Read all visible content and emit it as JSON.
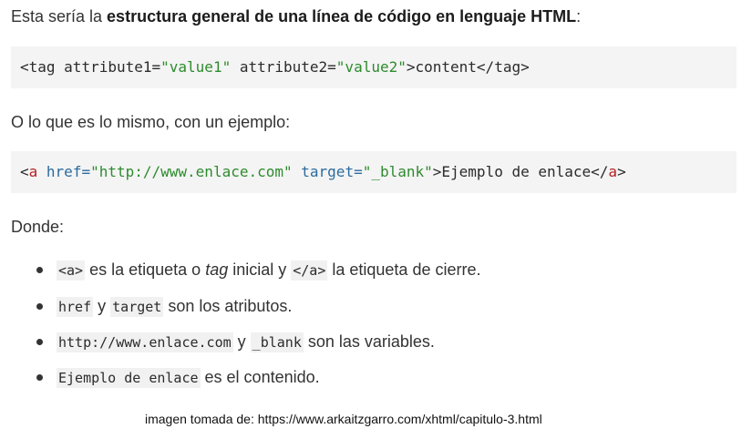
{
  "intro": {
    "prefix": "Esta sería la ",
    "bold": "estructura general de una línea de código en lenguaje HTML",
    "suffix": ":"
  },
  "code1": {
    "open": "<tag ",
    "attr1": "attribute1=",
    "val1": "\"value1\"",
    "attr2": " attribute2=",
    "val2": "\"value2\"",
    "close": ">content</tag>"
  },
  "example_intro": "O lo que es lo mismo, con un ejemplo:",
  "code2": {
    "lt": "<",
    "tag": "a",
    "href_attr": " href=",
    "href_val": "\"http://www.enlace.com\"",
    "target_attr": " target=",
    "target_val": "\"_blank\"",
    "mid": ">Ejemplo de enlace</",
    "end_tag": "a",
    "gt": ">"
  },
  "donde": "Donde:",
  "bullets": [
    {
      "code1": "<a>",
      "t1": " es la etiqueta o ",
      "em": "tag",
      "t2": " inicial y ",
      "code2": "</a>",
      "t3": " la etiqueta de cierre."
    },
    {
      "code1": "href",
      "t1": " y ",
      "code2": "target",
      "t2": " son los atributos."
    },
    {
      "code1": "http://www.enlace.com",
      "t1": " y ",
      "code2": "_blank",
      "t2": " son las variables."
    },
    {
      "code1": "Ejemplo de enlace",
      "t1": " es el contenido."
    }
  ],
  "credit": "imagen tomada de: https://www.arkaitzgarro.com/xhtml/capitulo-3.html"
}
